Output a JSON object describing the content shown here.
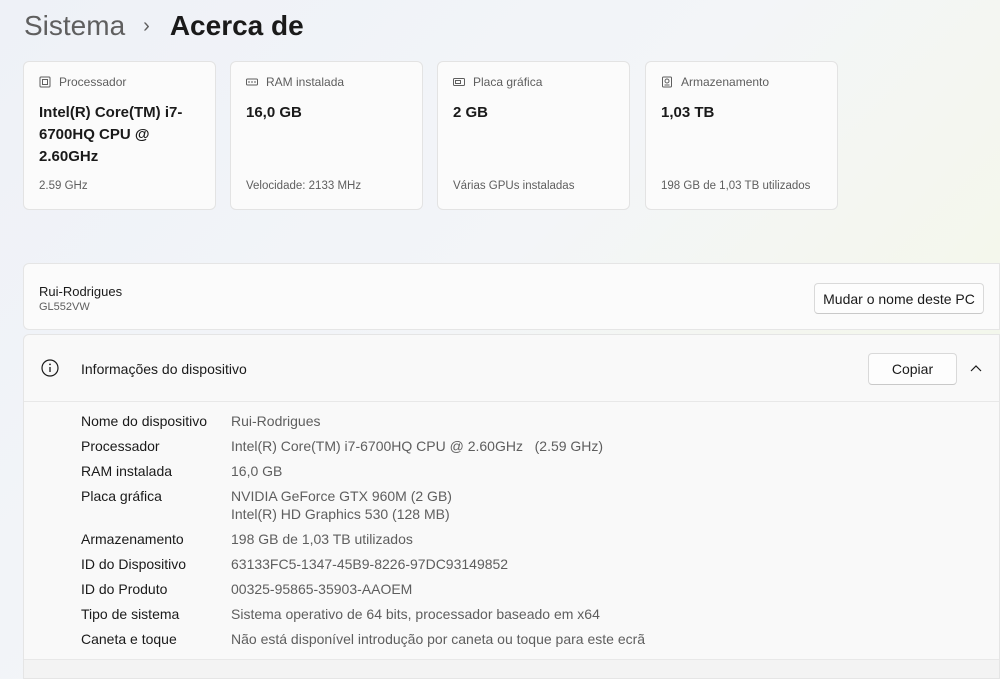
{
  "breadcrumb": {
    "parent": "Sistema",
    "separator": "›",
    "title": "Acerca de"
  },
  "cards": [
    {
      "icon": "processor-icon",
      "label": "Processador",
      "value": "Intel(R) Core(TM) i7-6700HQ CPU @ 2.60GHz",
      "sub": "2.59 GHz"
    },
    {
      "icon": "ram-icon",
      "label": "RAM instalada",
      "value": "16,0 GB",
      "sub": "Velocidade: 2133 MHz"
    },
    {
      "icon": "gpu-icon",
      "label": "Placa gráfica",
      "value": "2 GB",
      "sub": "Várias GPUs instaladas"
    },
    {
      "icon": "storage-icon",
      "label": "Armazenamento",
      "value": "1,03 TB",
      "sub": "198 GB de 1,03 TB utilizados"
    }
  ],
  "pc": {
    "name": "Rui-Rodrigues",
    "model": "GL552VW",
    "rename_label": "Mudar o nome deste PC"
  },
  "device_info": {
    "icon": "info-icon",
    "title": "Informações do dispositivo",
    "copy_label": "Copiar",
    "rows": [
      {
        "key": "Nome do dispositivo",
        "value": "Rui-Rodrigues"
      },
      {
        "key": "Processador",
        "value": "Intel(R) Core(TM) i7-6700HQ CPU @ 2.60GHz   (2.59 GHz)"
      },
      {
        "key": "RAM instalada",
        "value": "16,0 GB"
      },
      {
        "key": "Placa gráfica",
        "value": "NVIDIA GeForce GTX 960M (2 GB)",
        "value2": "Intel(R) HD Graphics 530 (128 MB)"
      },
      {
        "key": "Armazenamento",
        "value": "198 GB de 1,03 TB utilizados"
      },
      {
        "key": "ID do Dispositivo",
        "value": "63133FC5-1347-45B9-8226-97DC93149852"
      },
      {
        "key": "ID do Produto",
        "value": "00325-95865-35903-AAOEM"
      },
      {
        "key": "Tipo de sistema",
        "value": "Sistema operativo de 64 bits, processador baseado em x64"
      },
      {
        "key": "Caneta e toque",
        "value": "Não está disponível introdução por caneta ou toque para este ecrã"
      }
    ]
  }
}
